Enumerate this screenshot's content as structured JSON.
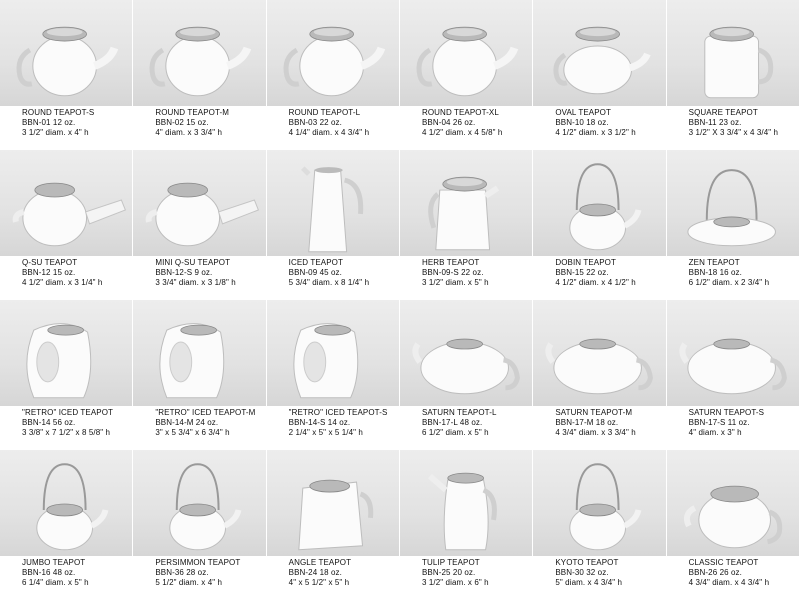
{
  "products": [
    {
      "name": "ROUND TEAPOT-S",
      "code": "BBN-01  12 oz.",
      "dims": "3 1/2\" diam. x 4\" h",
      "shape": "round-teapot-icon"
    },
    {
      "name": "ROUND TEAPOT-M",
      "code": "BBN-02  15 oz.",
      "dims": "4\" diam. x 3 3/4\" h",
      "shape": "round-teapot-icon"
    },
    {
      "name": "ROUND TEAPOT-L",
      "code": "BBN-03  22 oz.",
      "dims": "4 1/4\" diam. x 4 3/4\" h",
      "shape": "round-teapot-icon"
    },
    {
      "name": "ROUND TEAPOT-XL",
      "code": "BBN-04  26 oz.",
      "dims": "4 1/2\" diam. x 4 5/8\" h",
      "shape": "round-teapot-icon"
    },
    {
      "name": "OVAL TEAPOT",
      "code": "BBN-10  18 oz.",
      "dims": "4 1/2\" diam. x 3 1/2\" h",
      "shape": "oval-teapot-icon"
    },
    {
      "name": "SQUARE TEAPOT",
      "code": "BBN-11  23 oz.",
      "dims": "3 1/2\" X 3 3/4\" x 4 3/4\" h",
      "shape": "square-teapot-icon"
    },
    {
      "name": "Q-SU TEAPOT",
      "code": "BBN-12  15 oz.",
      "dims": "4 1/2\" diam. x 3 1/4\" h",
      "shape": "side-handle-teapot-icon"
    },
    {
      "name": "MINI Q-SU TEAPOT",
      "code": "BBN-12-S  9 oz.",
      "dims": "3 3/4\" diam. x 3 1/8\" h",
      "shape": "side-handle-teapot-icon"
    },
    {
      "name": "ICED TEAPOT",
      "code": "BBN-09  45 oz.",
      "dims": "5 3/4\" diam. x 8 1/4\" h",
      "shape": "tall-pitcher-icon"
    },
    {
      "name": "HERB TEAPOT",
      "code": "BBN-09-S  22 oz.",
      "dims": "3 1/2\" diam. x 5\" h",
      "shape": "pitcher-teapot-icon"
    },
    {
      "name": "DOBIN TEAPOT",
      "code": "BBN-15  22 oz.",
      "dims": "4 1/2\" diam. x 4 1/2\" h",
      "shape": "wire-handle-teapot-icon"
    },
    {
      "name": "ZEN TEAPOT",
      "code": "BBN-18  16 oz.",
      "dims": "6 1/2\" diam. x 2 3/4\" h",
      "shape": "flat-wire-handle-teapot-icon"
    },
    {
      "name": "\"RETRO\" ICED TEAPOT",
      "code": "BBN-14  56 oz.",
      "dims": "3 3/8\" x 7 1/2\" x 8 5/8\" h",
      "shape": "retro-teapot-icon"
    },
    {
      "name": "\"RETRO\" ICED TEAPOT-M",
      "code": "BBN-14-M  24 oz.",
      "dims": "3\" x 5 3/4\" x 6 3/4\" h",
      "shape": "retro-teapot-icon"
    },
    {
      "name": "\"RETRO\" ICED TEAPOT-S",
      "code": "BBN-14-S  14 oz.",
      "dims": "2 1/4\" x 5\" x 5 1/4\" h",
      "shape": "retro-teapot-icon"
    },
    {
      "name": "SATURN TEAPOT-L",
      "code": "BBN-17-L  48 oz.",
      "dims": "6 1/2\" diam. x 5\" h",
      "shape": "saturn-teapot-icon"
    },
    {
      "name": "SATURN TEAPOT-M",
      "code": "BBN-17-M  18 oz.",
      "dims": "4 3/4\" diam. x 3 3/4\" h",
      "shape": "saturn-teapot-icon"
    },
    {
      "name": "SATURN TEAPOT-S",
      "code": "BBN-17-S  11 oz.",
      "dims": "4\" diam. x 3\" h",
      "shape": "saturn-teapot-icon"
    },
    {
      "name": "JUMBO TEAPOT",
      "code": "BBN-16  48 oz.",
      "dims": "6 1/4\" diam. x 5\" h",
      "shape": "wire-handle-teapot-icon"
    },
    {
      "name": "PERSIMMON TEAPOT",
      "code": "BBN-36  28 oz.",
      "dims": "5 1/2\" diam. x 4\" h",
      "shape": "wire-handle-teapot-icon"
    },
    {
      "name": "ANGLE TEAPOT",
      "code": "BBN-24  18 oz.",
      "dims": "4\" x 5 1/2\" x 5\" h",
      "shape": "angle-teapot-icon"
    },
    {
      "name": "TULIP TEAPOT",
      "code": "BBN-25  20 oz.",
      "dims": "3 1/2\" diam. x 6\" h",
      "shape": "tulip-teapot-icon"
    },
    {
      "name": "KYOTO TEAPOT",
      "code": "BBN-30  32 oz.",
      "dims": "5\" diam. x 4 3/4\" h",
      "shape": "wire-handle-teapot-icon"
    },
    {
      "name": "CLASSIC TEAPOT",
      "code": "BBN-26  26 oz.",
      "dims": "4 3/4\" diam. x 4 3/4\" h",
      "shape": "classic-teapot-icon"
    }
  ]
}
